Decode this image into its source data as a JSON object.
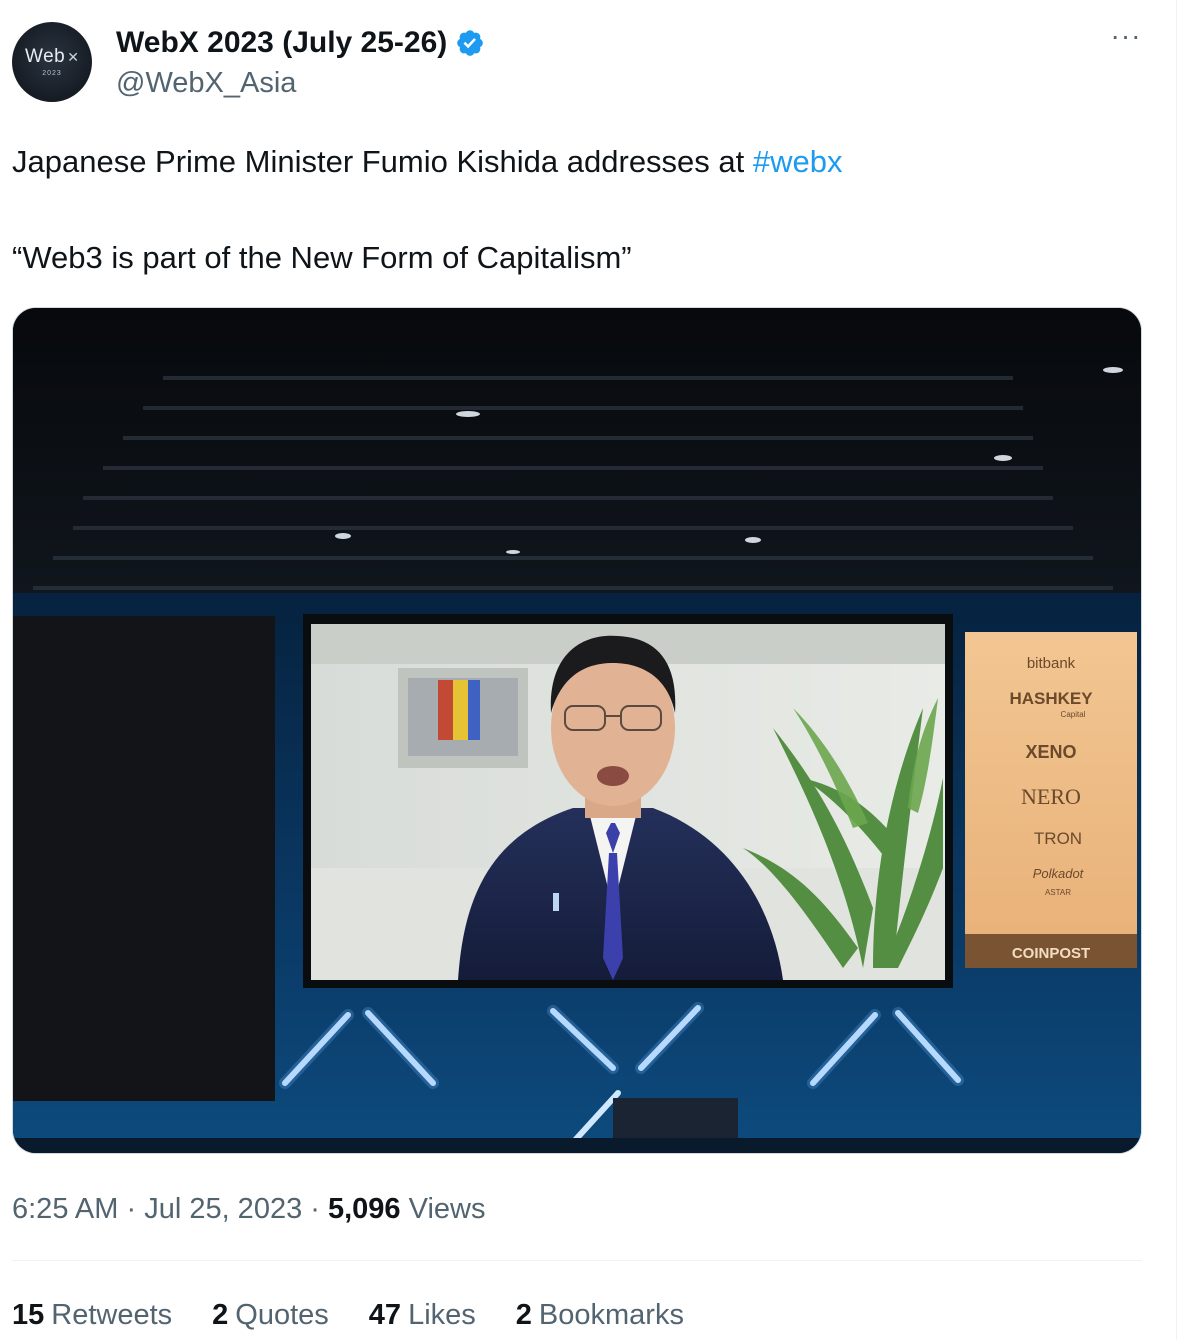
{
  "author": {
    "display_name": "WebX 2023 (July 25-26)",
    "handle": "@WebX_Asia",
    "verified": true,
    "avatar": {
      "logo_text": "Web",
      "logo_mark": "✕",
      "logo_year": "2023"
    }
  },
  "post": {
    "text_before_hashtag": "Japanese Prime Minister Fumio Kishida addresses at ",
    "hashtag": "#webx",
    "quote": "“Web3 is part of the New Form of Capitalism”"
  },
  "media": {
    "banner_sponsors": [
      "bitbank",
      "HASHKEY",
      "Capital",
      "XENO",
      "NERO",
      "TRON",
      "Polkadot",
      "ASTAR",
      "COINPOST"
    ]
  },
  "meta": {
    "time": "6:25 AM",
    "separator": " · ",
    "date": "Jul 25, 2023",
    "views_count": "5,096",
    "views_label": " Views"
  },
  "stats": {
    "retweets": {
      "count": "15",
      "label": "Retweets"
    },
    "quotes": {
      "count": "2",
      "label": "Quotes"
    },
    "likes": {
      "count": "47",
      "label": "Likes"
    },
    "bookmarks": {
      "count": "2",
      "label": "Bookmarks"
    }
  },
  "colors": {
    "link": "#1d9bf0",
    "secondary_text": "#536471",
    "verified": "#1d9bf0"
  }
}
